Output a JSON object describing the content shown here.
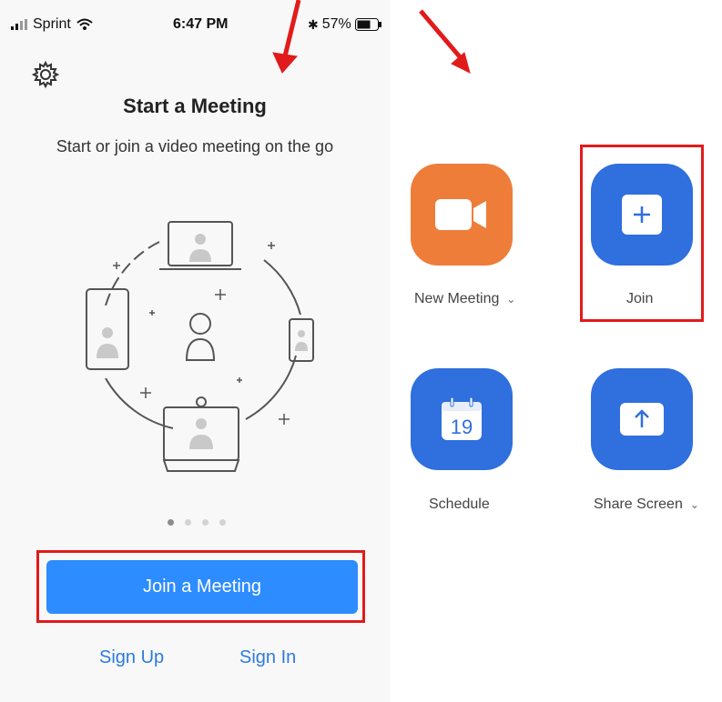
{
  "status_bar": {
    "carrier": "Sprint",
    "time": "6:47 PM",
    "battery": "57%"
  },
  "left_panel": {
    "settings_icon": "gear-icon",
    "title": "Start a Meeting",
    "subtitle": "Start or join a video meeting on the go",
    "carousel_pages": 4,
    "carousel_active": 1,
    "join_button": "Join a Meeting",
    "sign_up": "Sign Up",
    "sign_in": "Sign In"
  },
  "right_panel": {
    "tiles": [
      {
        "label": "New Meeting",
        "icon": "video-camera-icon",
        "color": "#ee7d3a",
        "has_dropdown": true
      },
      {
        "label": "Join",
        "icon": "plus-icon",
        "color": "#2f6fde",
        "has_dropdown": false
      },
      {
        "label": "Schedule",
        "icon": "calendar-icon",
        "icon_text": "19",
        "color": "#2f6fde",
        "has_dropdown": false
      },
      {
        "label": "Share Screen",
        "icon": "share-up-arrow-icon",
        "color": "#2f6fde",
        "has_dropdown": true
      }
    ]
  },
  "colors": {
    "primary_blue": "#2d8cff",
    "link_blue": "#2d7ae0",
    "annotation_red": "#e11b1b",
    "orange": "#ee7d3a"
  }
}
